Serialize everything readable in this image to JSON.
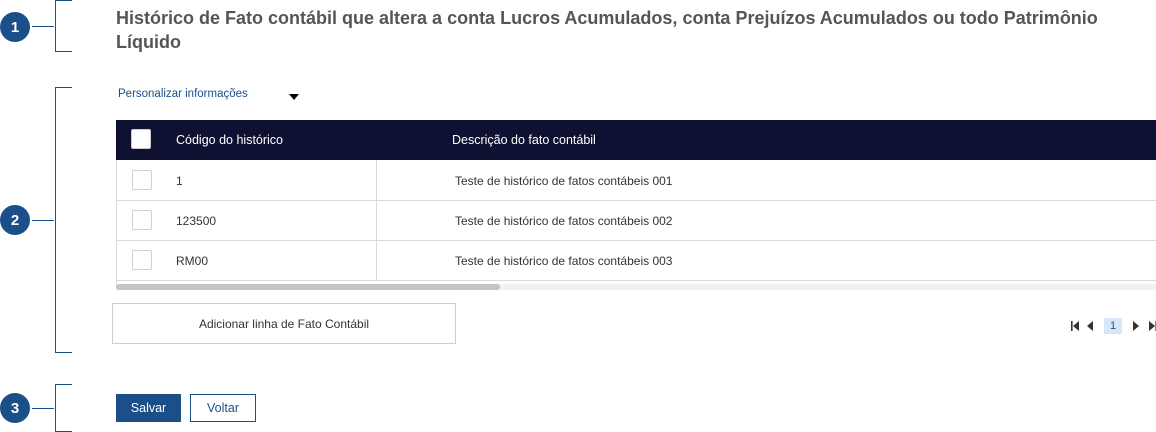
{
  "markers": [
    "1",
    "2",
    "3"
  ],
  "title": "Histórico de Fato contábil que altera a conta Lucros Acumulados, conta Prejuízos Acumulados ou todo Patrimônio Líquido",
  "customize_label": "Personalizar informações",
  "table": {
    "columns": [
      "Código do histórico",
      "Descrição do fato contábil"
    ],
    "rows": [
      {
        "code": "1",
        "description": "Teste de histórico de fatos contábeis 001"
      },
      {
        "code": "123500",
        "description": "Teste de histórico de fatos contábeis 002"
      },
      {
        "code": "RM00",
        "description": "Teste de histórico de fatos contábeis 003"
      }
    ]
  },
  "add_row_label": "Adicionar linha de Fato Contábil",
  "pagination": {
    "current_page": "1"
  },
  "actions": {
    "save_label": "Salvar",
    "back_label": "Voltar"
  },
  "colors": {
    "primary": "#1b4f8a",
    "table_header": "#0f1133",
    "page_highlight": "#d8e6f5"
  }
}
